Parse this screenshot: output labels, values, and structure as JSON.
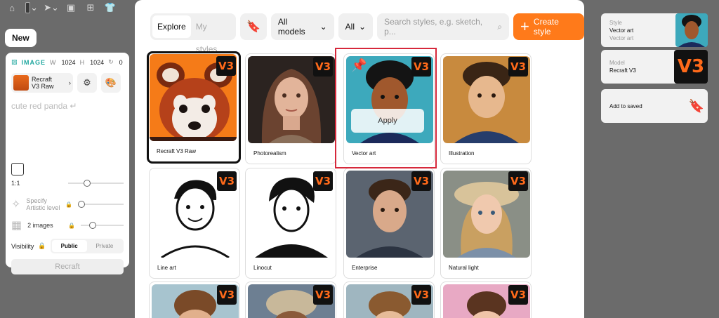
{
  "new_label": "New",
  "left_panel": {
    "image_tag": "IMAGE",
    "w_label": "W",
    "w_value": "1024",
    "h_label": "H",
    "h_value": "1024",
    "rot_value": "0",
    "model_line1": "Recraft",
    "model_line2": "V3 Raw",
    "prompt": "cute red panda",
    "ratio": "1:1",
    "artistic_line1": "Specify",
    "artistic_line2": "Artistic level",
    "images": "2 images",
    "visibility_label": "Visibility",
    "public": "Public",
    "private": "Private",
    "recraft_button": "Recraft"
  },
  "dialog": {
    "tab_explore": "Explore",
    "tab_my_styles": "My styles",
    "models_dropdown": "All models",
    "all_dropdown": "All",
    "search_placeholder": "Search styles, e.g. sketch, p...",
    "create_style": "Create style",
    "apply": "Apply",
    "badge": "V3",
    "styles": [
      {
        "name": "Recraft V3 Raw"
      },
      {
        "name": "Photorealism"
      },
      {
        "name": "Vector art"
      },
      {
        "name": "Illustration"
      },
      {
        "name": "Line art"
      },
      {
        "name": "Linocut"
      },
      {
        "name": "Enterprise"
      },
      {
        "name": "Natural light"
      }
    ]
  },
  "right_panel": {
    "style_label": "Style",
    "style_value": "Vector art",
    "style_sub": "Vector art",
    "model_label": "Model",
    "model_value": "Recraft V3",
    "model_badge": "V3",
    "add_saved": "Add to saved"
  },
  "colors": {
    "accent": "#ff7a1a",
    "highlight": "#d6283b"
  }
}
